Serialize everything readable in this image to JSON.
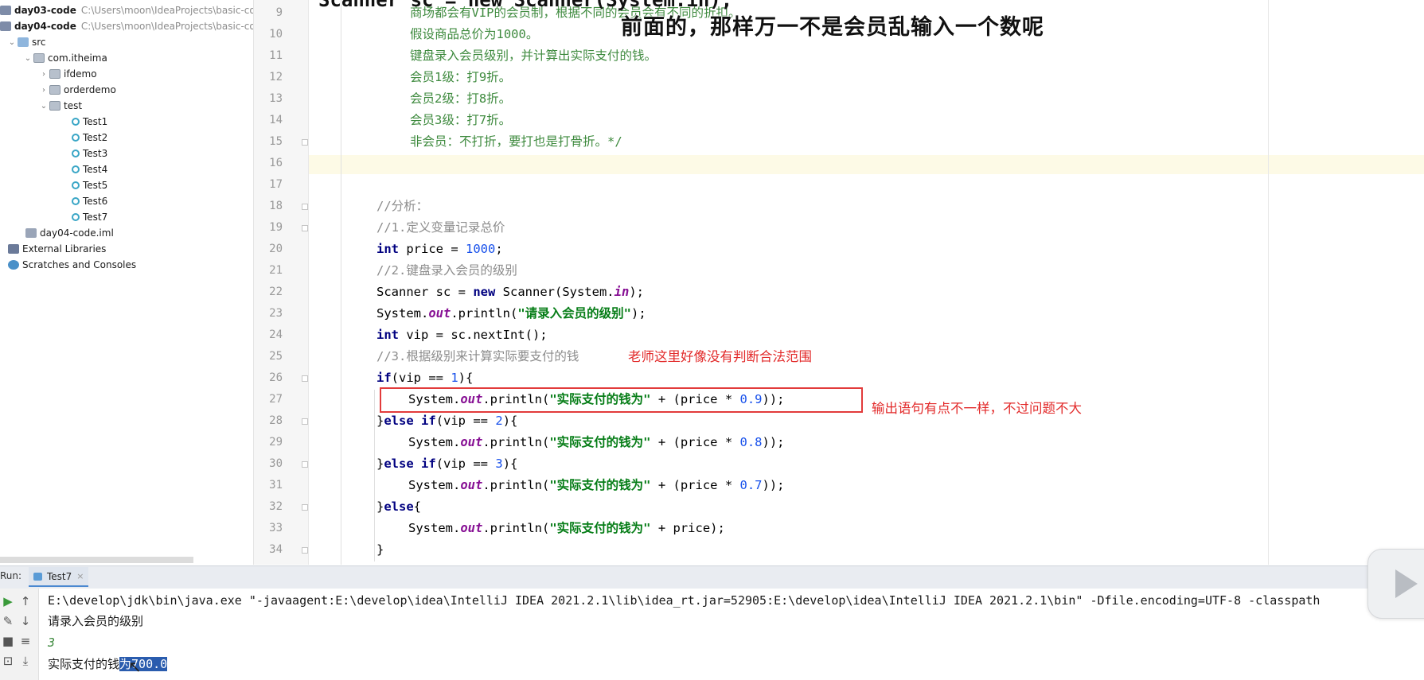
{
  "project_tree": {
    "items": [
      {
        "label": "day03-code",
        "path": "C:\\Users\\moon\\IdeaProjects\\basic-co",
        "bold": true
      },
      {
        "label": "day04-code",
        "path": "C:\\Users\\moon\\IdeaProjects\\basic-co",
        "bold": true
      },
      {
        "label": "src"
      },
      {
        "label": "com.itheima"
      },
      {
        "label": "ifdemo"
      },
      {
        "label": "orderdemo"
      },
      {
        "label": "test"
      },
      {
        "label": "Test1"
      },
      {
        "label": "Test2"
      },
      {
        "label": "Test3"
      },
      {
        "label": "Test4"
      },
      {
        "label": "Test5"
      },
      {
        "label": "Test6"
      },
      {
        "label": "Test7"
      },
      {
        "label": "day04-code.iml"
      },
      {
        "label": "External Libraries"
      },
      {
        "label": "Scratches and Consoles"
      }
    ]
  },
  "editor": {
    "line_numbers": [
      "9",
      "10",
      "11",
      "12",
      "13",
      "14",
      "15",
      "16",
      "17",
      "18",
      "19",
      "20",
      "21",
      "22",
      "23",
      "24",
      "25",
      "26",
      "27",
      "28",
      "29",
      "30",
      "31",
      "32",
      "33",
      "34"
    ],
    "top_cut_text": "Scanner sc = new Scanner(System.in);",
    "doc_lines": [
      "商场都会有VIP的会员制，根据不同的会员会有不同的折扣。",
      "假设商品总价为1000。",
      "键盘录入会员级别，并计算出实际支付的钱。",
      "会员1级：打9折。",
      "会员2级：打8折。",
      "会员3级：打7折。",
      "非会员：不打折，要打也是打骨折。*/"
    ],
    "c18": "//分析：",
    "c19": "//1.定义变量记录总价",
    "l20": {
      "kw": "int",
      "mid": " price = ",
      "num": "1000",
      "end": ";"
    },
    "c21": "//2.键盘录入会员的级别",
    "l22": {
      "a": "Scanner sc = ",
      "kw": "new",
      "b": " Scanner(System.",
      "fld": "in",
      "c": ");"
    },
    "l23": {
      "a": "System.",
      "fld": "out",
      "b": ".println(",
      "str": "\"请录入会员的级别\"",
      "c": ");"
    },
    "l24": {
      "kw": "int",
      "b": " vip = sc.nextInt();"
    },
    "c25": "//3.根据级别来计算实际要支付的钱",
    "l26": {
      "kw": "if",
      "a": "(vip == ",
      "num": "1",
      "b": "){"
    },
    "l27": {
      "a": "System.",
      "fld": "out",
      "b": ".println(",
      "str": "\"实际支付的钱为\"",
      "c": " + (price * ",
      "num": "0.9",
      "d": "));"
    },
    "l28": {
      "a": "}",
      "kw1": "else",
      "sp": " ",
      "kw2": "if",
      "b": "(vip == ",
      "num": "2",
      "c": "){"
    },
    "l29": {
      "a": "System.",
      "fld": "out",
      "b": ".println(",
      "str": "\"实际支付的钱为\"",
      "c": " + (price * ",
      "num": "0.8",
      "d": "));"
    },
    "l30": {
      "a": "}",
      "kw1": "else",
      "sp": " ",
      "kw2": "if",
      "b": "(vip == ",
      "num": "3",
      "c": "){"
    },
    "l31": {
      "a": "System.",
      "fld": "out",
      "b": ".println(",
      "str": "\"实际支付的钱为\"",
      "c": " + (price * ",
      "num": "0.7",
      "d": "));"
    },
    "l32": {
      "a": "}",
      "kw": "else",
      "b": "{"
    },
    "l33": {
      "a": "System.",
      "fld": "out",
      "b": ".println(",
      "str": "\"实际支付的钱为\"",
      "c": " + price);"
    },
    "l34": "}"
  },
  "subtitle": "前面的，那样万一不是会员乱输入一个数呢",
  "annotations": {
    "note1": "老师这里好像没有判断合法范围",
    "note2": "输出语句有点不一样，不过问题不大"
  },
  "run_panel": {
    "label": "Run:",
    "tab": "Test7",
    "close": "×",
    "command": "E:\\develop\\jdk\\bin\\java.exe \"-javaagent:E:\\develop\\idea\\IntelliJ IDEA 2021.2.1\\lib\\idea_rt.jar=52905:E:\\develop\\idea\\IntelliJ IDEA 2021.2.1\\bin\" -Dfile.encoding=UTF-8 -classpath",
    "prompt": "请录入会员的级别",
    "input": "3",
    "result_plain": "实际支付的钱",
    "result_selected": "为700.0"
  },
  "colors": {
    "accent": "#4a88d0",
    "annotation": "#e22a2a",
    "selection": "#2a5cae"
  }
}
